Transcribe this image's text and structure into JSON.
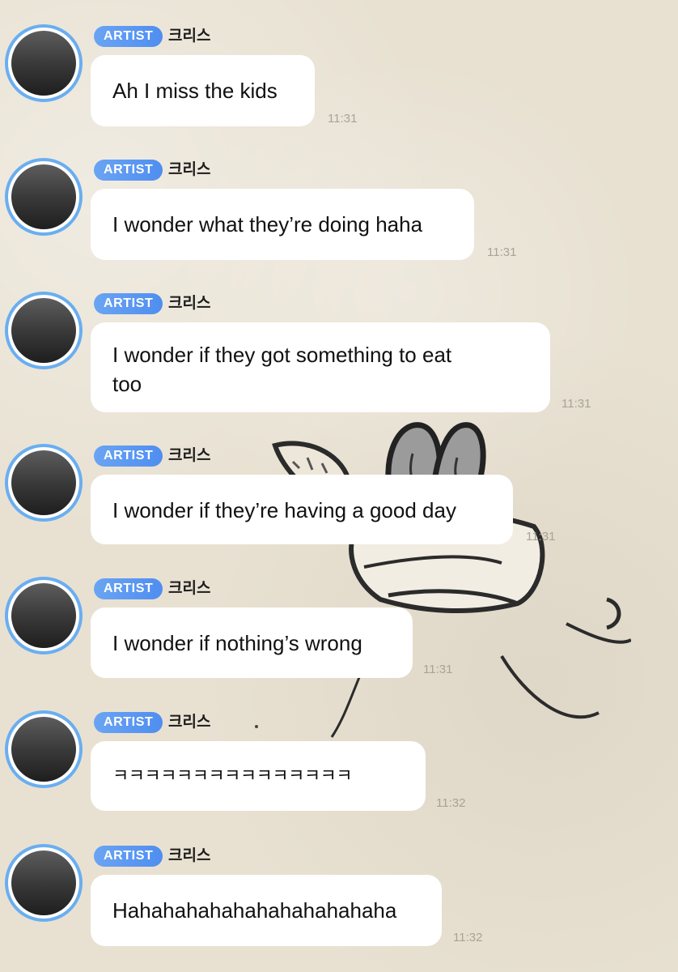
{
  "messages": [
    {
      "badge": "ARTIST",
      "author": "크리스",
      "text": "Ah I miss the kids",
      "time": "11:31"
    },
    {
      "badge": "ARTIST",
      "author": "크리스",
      "text": "I wonder what they’re doing haha",
      "time": "11:31"
    },
    {
      "badge": "ARTIST",
      "author": "크리스",
      "text": "I wonder if they got something to eat\ntoo",
      "time": "11:31"
    },
    {
      "badge": "ARTIST",
      "author": "크리스",
      "text": "I wonder if they’re having a good day",
      "time": "11:31"
    },
    {
      "badge": "ARTIST",
      "author": "크리스",
      "text": "I wonder if nothing’s wrong",
      "time": "11:31"
    },
    {
      "badge": "ARTIST",
      "author": "크리스",
      "text": "ㅋㅋㅋㅋㅋㅋㅋㅋㅋㅋㅋㅋㅋㅋㅋ",
      "time": "11:32"
    },
    {
      "badge": "ARTIST",
      "author": "크리스",
      "text": "Hahahahahahahahahahahaha",
      "time": "11:32"
    }
  ],
  "colors": {
    "badge_blue": "#5b98f2",
    "avatar_ring": "#6aaef0",
    "bubble": "#ffffff",
    "timestamp": "#a8a397"
  }
}
